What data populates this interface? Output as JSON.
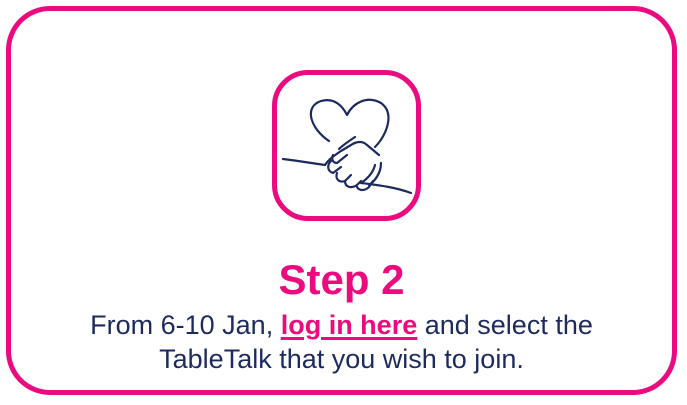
{
  "card": {
    "title": "Step 2",
    "desc_before": "From 6-10 Jan, ",
    "link_text": "log in here",
    "desc_after": " and select the",
    "desc_line2": "TableTalk that you wish to join."
  },
  "icon": {
    "name": "handshake-heart-icon"
  },
  "colors": {
    "accent": "#ec0b7f",
    "text": "#1c2a5e"
  }
}
